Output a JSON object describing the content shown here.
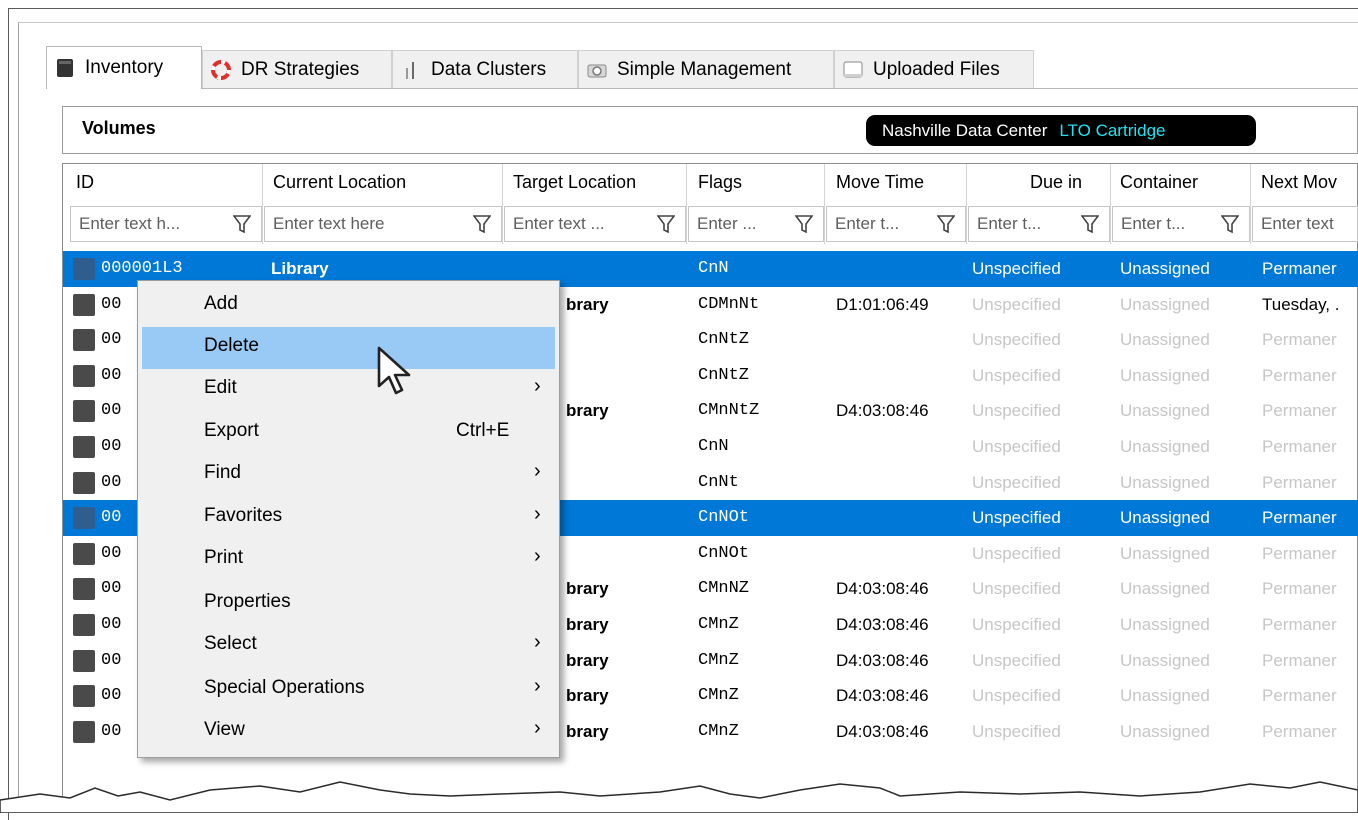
{
  "tabs": [
    {
      "label": "Inventory",
      "icon": "tape-icon",
      "active": true
    },
    {
      "label": "DR Strategies",
      "icon": "lifebuoy-icon"
    },
    {
      "label": "Data Clusters",
      "icon": "data-clusters-icon"
    },
    {
      "label": "Simple Management",
      "icon": "camera-icon"
    },
    {
      "label": "Uploaded Files",
      "icon": "window-icon"
    }
  ],
  "panel": {
    "title": "Volumes",
    "location": "Nashville Data Center",
    "media": "LTO Cartridge",
    "colors": {
      "pill_bg": "#000000",
      "media_text": "#21e3f0",
      "selection": "#0078d7",
      "menu_highlight": "#99c9f5"
    }
  },
  "columns": [
    {
      "header": "ID",
      "placeholder": "Enter text h..."
    },
    {
      "header": "Current Location",
      "placeholder": "Enter text here"
    },
    {
      "header": "Target Location",
      "placeholder": "Enter text ..."
    },
    {
      "header": "Flags",
      "placeholder": "Enter ..."
    },
    {
      "header": "Move Time",
      "placeholder": "Enter t..."
    },
    {
      "header": "Due in",
      "placeholder": "Enter t..."
    },
    {
      "header": "Container",
      "placeholder": "Enter t..."
    },
    {
      "header": "Next Mov",
      "placeholder": "Enter text"
    }
  ],
  "rows": [
    {
      "id": "000001L3",
      "current": "Library",
      "target": "",
      "flags": "CnN",
      "move": "",
      "due": "Unspecified",
      "container": "Unassigned",
      "next": "Permaner",
      "selected": true
    },
    {
      "id": "00",
      "current": "",
      "target": "brary",
      "flags": "CDMnNt",
      "move": "D1:01:06:49",
      "due": "Unspecified",
      "container": "Unassigned",
      "next": "Tuesday, ."
    },
    {
      "id": "00",
      "current": "",
      "target": "",
      "flags": "CnNtZ",
      "move": "",
      "due": "Unspecified",
      "container": "Unassigned",
      "next": "Permaner"
    },
    {
      "id": "00",
      "current": "",
      "target": "",
      "flags": "CnNtZ",
      "move": "",
      "due": "Unspecified",
      "container": "Unassigned",
      "next": "Permaner"
    },
    {
      "id": "00",
      "current": "",
      "target": "brary",
      "flags": "CMnNtZ",
      "move": "D4:03:08:46",
      "due": "Unspecified",
      "container": "Unassigned",
      "next": "Permaner"
    },
    {
      "id": "00",
      "current": "",
      "target": "",
      "flags": "CnN",
      "move": "",
      "due": "Unspecified",
      "container": "Unassigned",
      "next": "Permaner"
    },
    {
      "id": "00",
      "current": "",
      "target": "",
      "flags": "CnNt",
      "move": "",
      "due": "Unspecified",
      "container": "Unassigned",
      "next": "Permaner"
    },
    {
      "id": "00",
      "current": "",
      "target": "",
      "flags": "CnNOt",
      "move": "",
      "due": "Unspecified",
      "container": "Unassigned",
      "next": "Permaner",
      "selected": true
    },
    {
      "id": "00",
      "current": "",
      "target": "",
      "flags": "CnNOt",
      "move": "",
      "due": "Unspecified",
      "container": "Unassigned",
      "next": "Permaner"
    },
    {
      "id": "00",
      "current": "",
      "target": "brary",
      "flags": "CMnNZ",
      "move": "D4:03:08:46",
      "due": "Unspecified",
      "container": "Unassigned",
      "next": "Permaner"
    },
    {
      "id": "00",
      "current": "",
      "target": "brary",
      "flags": "CMnZ",
      "move": "D4:03:08:46",
      "due": "Unspecified",
      "container": "Unassigned",
      "next": "Permaner"
    },
    {
      "id": "00",
      "current": "",
      "target": "brary",
      "flags": "CMnZ",
      "move": "D4:03:08:46",
      "due": "Unspecified",
      "container": "Unassigned",
      "next": "Permaner"
    },
    {
      "id": "00",
      "current": "",
      "target": "brary",
      "flags": "CMnZ",
      "move": "D4:03:08:46",
      "due": "Unspecified",
      "container": "Unassigned",
      "next": "Permaner"
    },
    {
      "id": "00",
      "current": "",
      "target": "brary",
      "flags": "CMnZ",
      "move": "D4:03:08:46",
      "due": "Unspecified",
      "container": "Unassigned",
      "next": "Permaner"
    }
  ],
  "menu": [
    {
      "label": "Add",
      "shortcut": "",
      "submenu": false
    },
    {
      "label": "Delete",
      "shortcut": "",
      "submenu": false,
      "highlighted": true
    },
    {
      "label": "Edit",
      "shortcut": "",
      "submenu": true
    },
    {
      "label": "Export",
      "shortcut": "Ctrl+E",
      "submenu": false
    },
    {
      "label": "Find",
      "shortcut": "",
      "submenu": true
    },
    {
      "label": "Favorites",
      "shortcut": "",
      "submenu": true
    },
    {
      "label": "Print",
      "shortcut": "",
      "submenu": true
    },
    {
      "label": "Properties",
      "shortcut": "",
      "submenu": false
    },
    {
      "label": "Select",
      "shortcut": "",
      "submenu": true
    },
    {
      "label": "Special Operations",
      "shortcut": "",
      "submenu": true
    },
    {
      "label": "View",
      "shortcut": "",
      "submenu": true
    }
  ]
}
